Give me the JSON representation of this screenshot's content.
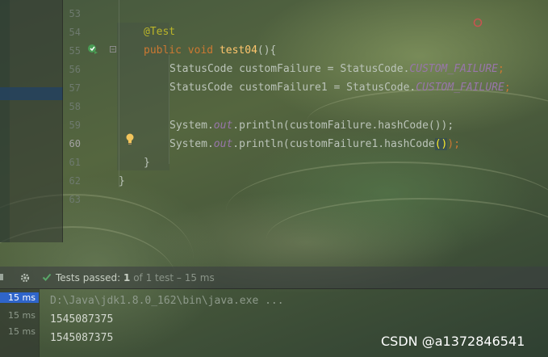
{
  "editor": {
    "line_numbers": [
      "53",
      "54",
      "55",
      "56",
      "57",
      "58",
      "59",
      "60",
      "61",
      "62",
      "63"
    ],
    "active_line": "60",
    "code": {
      "l54_annotation": "@Test",
      "l55_public": "public",
      "l55_void": "void",
      "l55_name": "test04",
      "l55_rest": "(){",
      "l56_pre": "StatusCode customFailure = StatusCode.",
      "l56_const": "CUSTOM_FAILURE",
      "l56_end": ";",
      "l57_pre": "StatusCode customFailure1 = StatusCode.",
      "l57_const": "CUSTOM_FAILURE",
      "l57_end": ";",
      "l59_sys": "System.",
      "l59_out": "out",
      "l59_rest": ".println(customFailure.hashCode());",
      "l60_sys": "System.",
      "l60_out": "out",
      "l60_rest": ".println(customFailure1.hashCode",
      "l60_paren": "()",
      "l60_end": ");",
      "l61_brace": "}",
      "l62_brace": "}"
    }
  },
  "run_panel": {
    "status_prefix": "Tests passed: ",
    "passed_count": "1",
    "status_suffix": " of 1 test – 15 ms",
    "times": [
      "15 ms",
      "15 ms",
      "15 ms"
    ],
    "output": [
      "D:\\Java\\jdk1.8.0_162\\bin\\java.exe ...",
      "1545087375",
      "1545087375"
    ]
  },
  "watermark": "CSDN @a1372846541",
  "colors": {
    "keyword": "#cc7832",
    "annotation": "#bbb529",
    "function": "#ffc66d",
    "constant": "#9876aa",
    "selection": "#2f65ca"
  },
  "icons": [
    "run-test-icon",
    "fold-icon",
    "bulb-icon",
    "error-mark-icon",
    "settings-gear-icon",
    "check-icon"
  ]
}
